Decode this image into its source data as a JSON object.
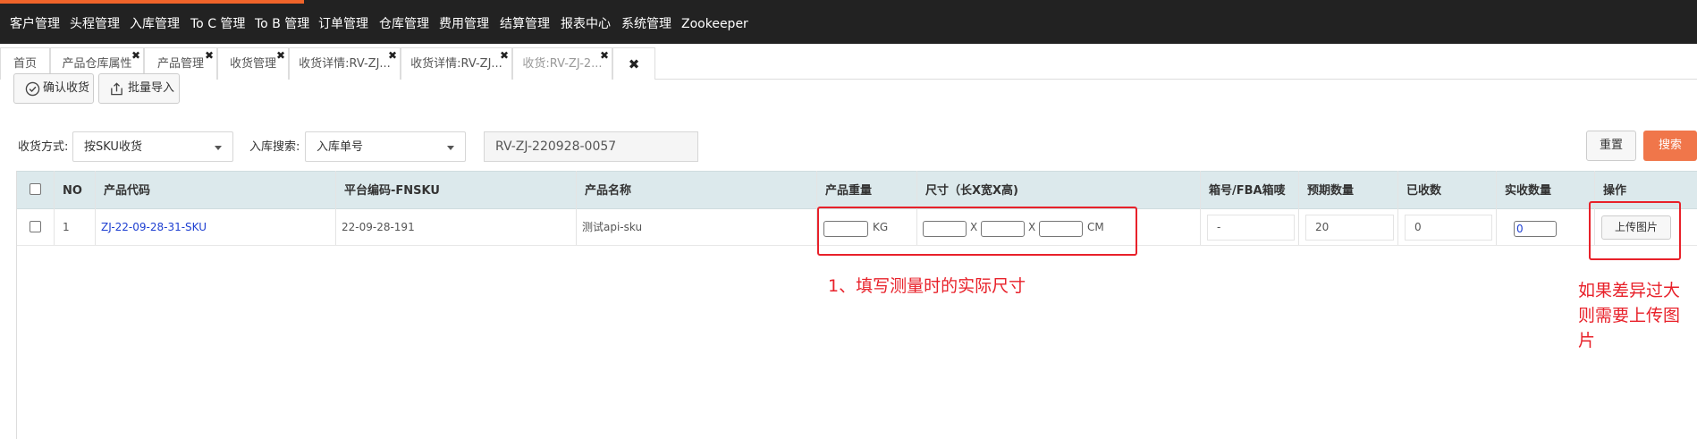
{
  "nav": {
    "items": [
      "客户管理",
      "头程管理",
      "入库管理",
      "To C 管理",
      "To B 管理",
      "订单管理",
      "仓库管理",
      "费用管理",
      "结算管理",
      "报表中心",
      "系统管理",
      "Zookeeper"
    ]
  },
  "tabs": [
    {
      "label": "首页",
      "closable": false,
      "active": false
    },
    {
      "label": "产品仓库属性",
      "closable": true,
      "active": false
    },
    {
      "label": "产品管理",
      "closable": true,
      "active": false
    },
    {
      "label": "收货管理",
      "closable": true,
      "active": false
    },
    {
      "label": "收货详情:RV-ZJ...",
      "closable": true,
      "active": false
    },
    {
      "label": "收货详情:RV-ZJ...",
      "closable": true,
      "active": false
    },
    {
      "label": "收货:RV-ZJ-2...",
      "closable": true,
      "active": true
    }
  ],
  "tab_close_glyph": "✖",
  "toolbar": {
    "confirm_label": "确认收货",
    "confirm_icon": "check-circle-icon",
    "import_label": "批量导入",
    "import_icon": "upload-icon"
  },
  "filters": {
    "method_label": "收货方式:",
    "method_value": "按SKU收货",
    "search_label": "入库搜索:",
    "search_type_value": "入库单号",
    "search_value": "RV-ZJ-220928-0057",
    "reset_label": "重置",
    "search_button_label": "搜索"
  },
  "table": {
    "headers": {
      "no": "NO",
      "code": "产品代码",
      "fnsku": "平台编码-FNSKU",
      "name": "产品名称",
      "weight": "产品重量",
      "size": "尺寸（长X宽X高)",
      "box": "箱号/FBA箱唛",
      "expected": "预期数量",
      "received": "已收数",
      "actual": "实收数量",
      "op": "操作"
    },
    "rows": [
      {
        "no": "1",
        "code": "ZJ-22-09-28-31-SKU",
        "fnsku": "22-09-28-191",
        "name": "测试api-sku",
        "weight": "",
        "weight_unit": "KG",
        "length": "",
        "width": "",
        "height": "",
        "size_sep": "X",
        "size_unit": "CM",
        "box": "-",
        "expected": "20",
        "received": "0",
        "actual": "0",
        "upload_label": "上传图片"
      }
    ]
  },
  "annotations": {
    "size_note": "1、填写测量时的实际尺寸",
    "upload_note_lines": [
      "如果差异过大",
      "则需要上传图",
      "片"
    ],
    "color": "#e8212a"
  },
  "colors": {
    "nav_bg": "#222222",
    "accent": "#f0642a",
    "search_button": "#f0764a",
    "table_header_bg": "#dce9ec",
    "link": "#1e3fd1"
  }
}
